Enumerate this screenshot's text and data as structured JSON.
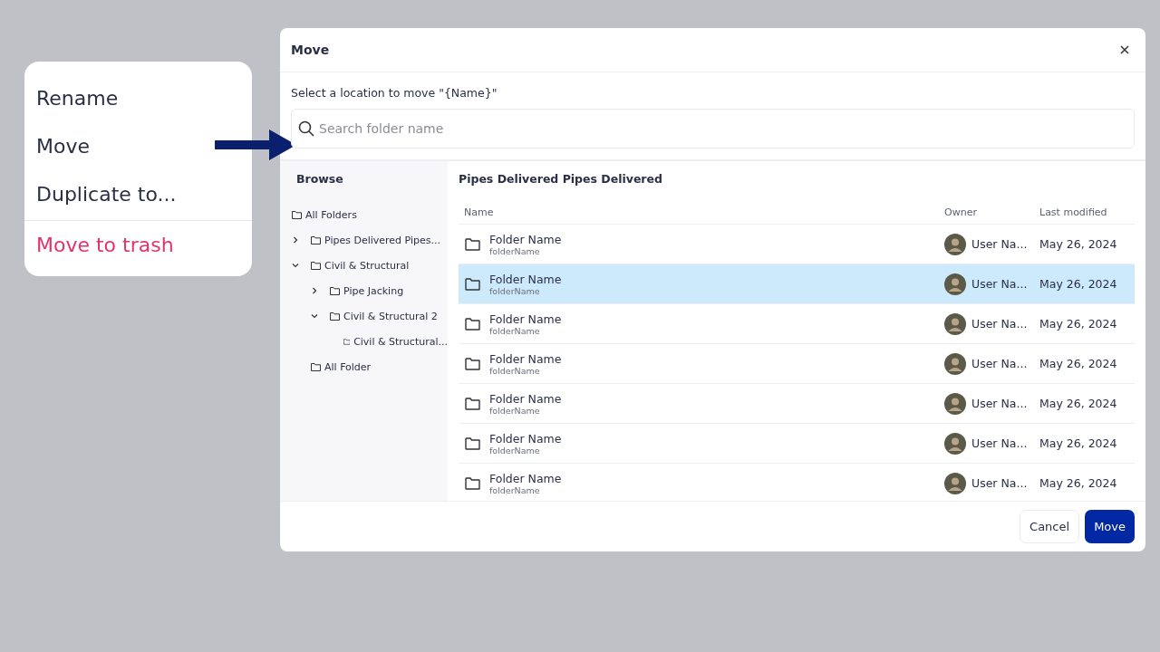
{
  "context_menu": {
    "items": [
      {
        "label": "Rename",
        "kind": "normal"
      },
      {
        "label": "Move",
        "kind": "normal"
      },
      {
        "label": "Duplicate to...",
        "kind": "normal"
      },
      {
        "label": "Move to trash",
        "kind": "danger"
      }
    ]
  },
  "dialog": {
    "title": "Move",
    "prompt": "Select a location to move \"{Name}\"",
    "search": {
      "placeholder": "Search folder name"
    },
    "browse": {
      "title": "Browse",
      "tree": [
        {
          "label": "All Folders",
          "children": [
            {
              "label": "Pipes Delivered Pipes...",
              "expanded": false
            },
            {
              "label": "Civil & Structural",
              "expanded": true,
              "children": [
                {
                  "label": "Pipe Jacking",
                  "expanded": false
                },
                {
                  "label": "Civil & Structural 2",
                  "expanded": true,
                  "children": [
                    {
                      "label": "Civil & Structural..."
                    }
                  ]
                }
              ]
            },
            {
              "label": "All Folder"
            }
          ]
        }
      ]
    },
    "content": {
      "title": "Pipes Delivered Pipes Delivered",
      "columns": [
        "Name",
        "Owner",
        "Last modified"
      ],
      "rows": [
        {
          "name": "Folder Name",
          "subname": "folderName",
          "owner": "User Na...",
          "modified": "May 26, 2024",
          "selected": false
        },
        {
          "name": "Folder Name",
          "subname": "folderName",
          "owner": "User Na...",
          "modified": "May 26, 2024",
          "selected": true
        },
        {
          "name": "Folder Name",
          "subname": "folderName",
          "owner": "User Na...",
          "modified": "May 26, 2024",
          "selected": false
        },
        {
          "name": "Folder Name",
          "subname": "folderName",
          "owner": "User Na...",
          "modified": "May 26, 2024",
          "selected": false
        },
        {
          "name": "Folder Name",
          "subname": "folderName",
          "owner": "User Na...",
          "modified": "May 26, 2024",
          "selected": false
        },
        {
          "name": "Folder Name",
          "subname": "folderName",
          "owner": "User Na...",
          "modified": "May 26, 2024",
          "selected": false
        },
        {
          "name": "Folder Name",
          "subname": "folderName",
          "owner": "User Na...",
          "modified": "May 26, 2024",
          "selected": false
        }
      ]
    },
    "buttons": [
      {
        "label": "Cancel",
        "kind": "secondary"
      },
      {
        "label": "Move",
        "kind": "primary"
      }
    ]
  }
}
